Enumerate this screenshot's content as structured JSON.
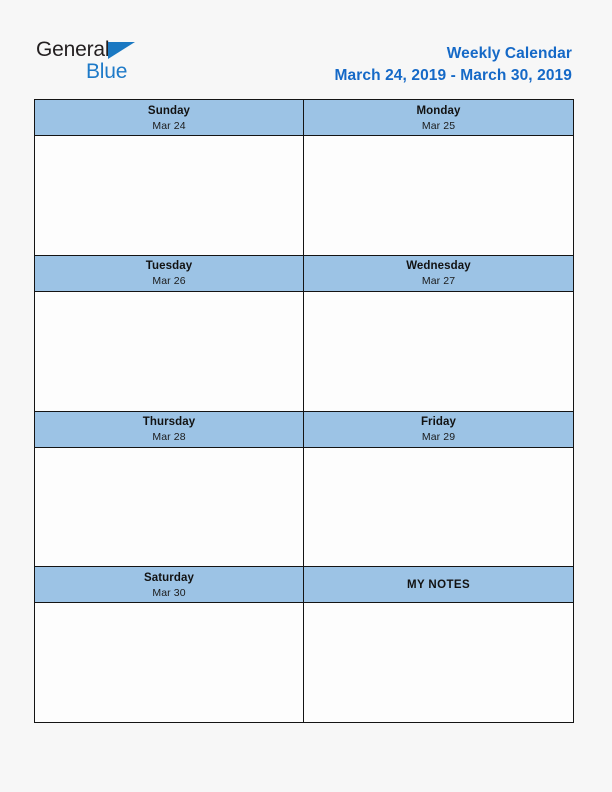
{
  "brand": {
    "word_one": "General",
    "word_two": "Blue",
    "triangle_icon": "triangle-icon",
    "color_dark": "#231f20",
    "color_blue": "#1e7ac8"
  },
  "header": {
    "title": "Weekly Calendar",
    "date_range": "March 24, 2019 - March 30, 2019",
    "title_color": "#1569c7"
  },
  "calendar": {
    "header_fill": "#9cc3e5",
    "border_color": "#141414",
    "cell_fill": "#fdfdfd",
    "rows": [
      {
        "left": {
          "day": "Sunday",
          "date": "Mar 24",
          "note_text": ""
        },
        "right": {
          "day": "Monday",
          "date": "Mar 25",
          "note_text": ""
        }
      },
      {
        "left": {
          "day": "Tuesday",
          "date": "Mar 26",
          "note_text": ""
        },
        "right": {
          "day": "Wednesday",
          "date": "Mar 27",
          "note_text": ""
        }
      },
      {
        "left": {
          "day": "Thursday",
          "date": "Mar 28",
          "note_text": ""
        },
        "right": {
          "day": "Friday",
          "date": "Mar 29",
          "note_text": ""
        }
      },
      {
        "left": {
          "day": "Saturday",
          "date": "Mar 30",
          "note_text": ""
        },
        "right": {
          "day": "MY NOTES",
          "date": "",
          "note_text": ""
        }
      }
    ]
  }
}
